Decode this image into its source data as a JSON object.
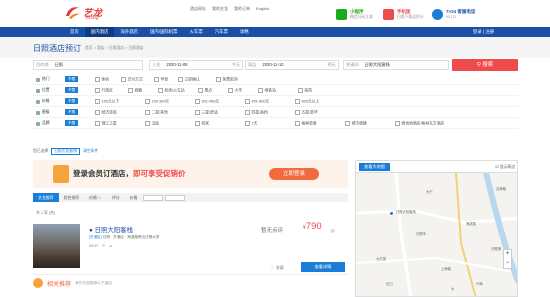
{
  "header": {
    "logo_cn": "艺龙",
    "logo_en": "eLong",
    "links": [
      "酒店网址",
      "我的艺龙",
      "我的订单",
      "English"
    ],
    "promos": [
      {
        "title": "小程序",
        "sub": "微信扫码立减",
        "color": "#1aad19"
      },
      {
        "title": "手机版",
        "sub": "扫描下载返积分",
        "color": "#f04b4c"
      },
      {
        "title": "7×24 客服电话",
        "sub": "95711",
        "color": "#1a7ed8"
      }
    ]
  },
  "nav": {
    "items": [
      "首页",
      "国内酒店",
      "海外酒店",
      "国内/国际机票",
      "火车票",
      "汽车票",
      "攻略"
    ],
    "login": "登录 | 注册"
  },
  "breadcrumb": {
    "title": "日照酒店预订",
    "path": "首页 > 酒店 > 日照酒店 > 日照酒店"
  },
  "search": {
    "city_label": "目的地",
    "city": "日照",
    "checkin_label": "入住",
    "checkin": "2020-11-09",
    "checkin_day": "今天",
    "checkout_label": "离店",
    "checkout": "2020-11-10",
    "checkout_day": "明天",
    "keyword_label": "关键词",
    "keyword": "日照大阳客栈",
    "button": "搜索"
  },
  "filters": [
    {
      "label": "热门",
      "all": "不限",
      "options": [
        "体验",
        "交付方式",
        "早餐",
        "立即确认",
        "免费取消"
      ]
    },
    {
      "label": "位置",
      "all": "不限",
      "options": [
        "行政区",
        "商圈",
        "机场/火车站",
        "景点",
        "大学",
        "地铁站",
        "医院"
      ]
    },
    {
      "label": "价格",
      "all": "不限",
      "options": [
        "150元以下",
        "150-300元",
        "301-450元",
        "451-600元",
        "600元以上"
      ]
    },
    {
      "label": "星级",
      "all": "不限",
      "options": [
        "经济连锁",
        "二星/其他",
        "三星/舒适",
        "四星/高档",
        "五星/豪华"
      ]
    },
    {
      "label": "品牌",
      "all": "不限",
      "options": [
        "锦江之星",
        "汉庭",
        "如家",
        "7天",
        "格林豪泰",
        "城市便捷",
        "维也纳酒店/格林东方酒店"
      ]
    }
  ],
  "selected": {
    "label": "您已选择",
    "tag": "日照大阳客栈",
    "clear": "清空条件"
  },
  "banner": {
    "text_a": "登录会员订酒店，",
    "text_b": "即可享受促销价",
    "button": "立即登录"
  },
  "sort": {
    "items": [
      "艺龙推荐",
      "综合排序",
      "价格 ↑↓",
      "评分",
      "价格"
    ],
    "count": "共 1 家 (共)"
  },
  "hotel": {
    "name": "日照大阳客栈",
    "tag": "[东港区]",
    "address": "日照 · 东港区 · 海滨路旁近日照大学",
    "facilities": [
      "Wi-Fi",
      "P",
      "☕"
    ],
    "score": "暂无点评",
    "price": "790",
    "currency": "¥",
    "price_suffix": "起",
    "fav": "收藏",
    "detail": "查看详情"
  },
  "related": {
    "title": "相关推荐",
    "sub": "我们为您推荐以下酒店"
  },
  "map": {
    "tab": "查看大地图",
    "checkbox": "显示周边",
    "labels": [
      "日照大阳客栈",
      "大宁",
      "日照市",
      "大古镇",
      "上海路",
      "海滨路",
      "沿海路",
      "石臼",
      "兴海",
      "日照港",
      "大"
    ]
  }
}
